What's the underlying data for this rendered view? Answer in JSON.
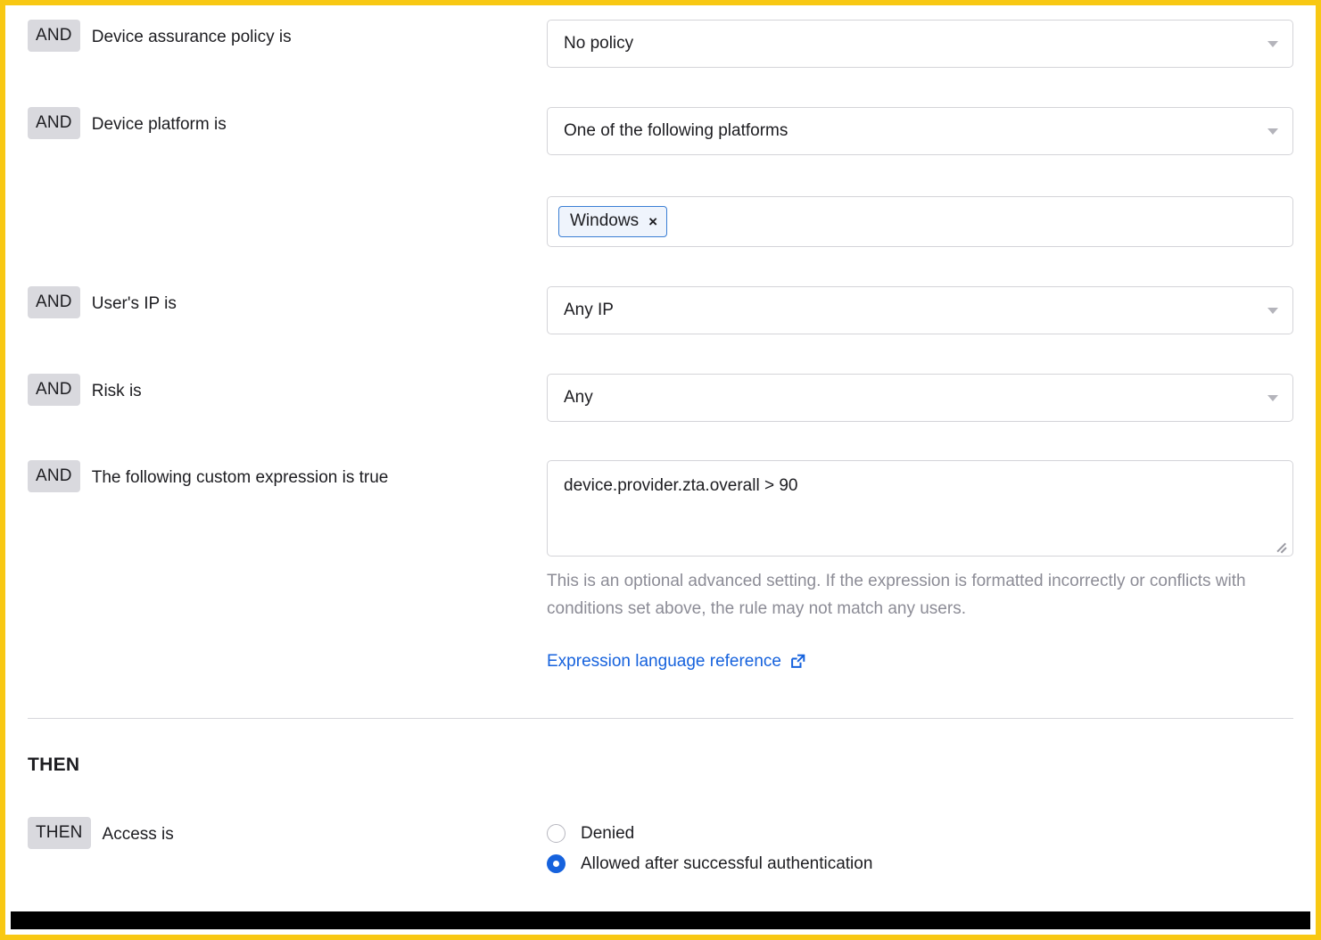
{
  "colors": {
    "accent_border": "#f8c813",
    "link": "#1662dd",
    "badge_bg": "#d9d9de",
    "chip_border": "#3b7fd4",
    "chip_bg": "#eff4fc",
    "radio_selected": "#1662dd"
  },
  "conditions": [
    {
      "connector": "AND",
      "label": "Device assurance policy is",
      "control": "select",
      "value": "No policy"
    },
    {
      "connector": "AND",
      "label": "Device platform is",
      "control": "select",
      "value": "One of the following platforms",
      "chips": [
        {
          "label": "Windows",
          "remove": "×"
        }
      ]
    },
    {
      "connector": "AND",
      "label": "User's IP is",
      "control": "select",
      "value": "Any IP"
    },
    {
      "connector": "AND",
      "label": "Risk is",
      "control": "select",
      "value": "Any"
    },
    {
      "connector": "AND",
      "label": "The following custom expression is true",
      "control": "textarea",
      "value": "device.provider.zta.overall > 90",
      "help": "This is an optional advanced setting. If the expression is formatted incorrectly or conflicts with conditions set above, the rule may not match any users.",
      "link": {
        "text": "Expression language reference",
        "icon": "external-link-icon"
      }
    }
  ],
  "then_section": {
    "heading": "THEN",
    "row": {
      "connector": "THEN",
      "label": "Access is",
      "options": [
        {
          "label": "Denied",
          "selected": false
        },
        {
          "label": "Allowed after successful authentication",
          "selected": true
        }
      ]
    }
  }
}
